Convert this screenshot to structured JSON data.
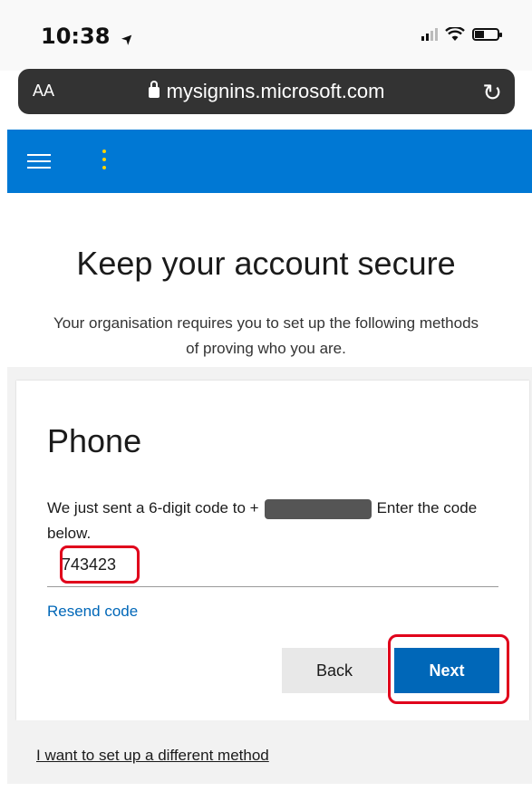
{
  "status_bar": {
    "time": "10:38",
    "location_arrow": "➤",
    "icons": [
      "signal-icon",
      "wifi-icon",
      "battery-icon"
    ]
  },
  "browser": {
    "text_size_label": "AA",
    "url": "mysignins.microsoft.com",
    "reload_glyph": "↻"
  },
  "header": {
    "accent": "#0078d4",
    "menu_icon": "hamburger-icon",
    "more_icon": "more-vertical-icon"
  },
  "page": {
    "title": "Keep your account secure",
    "subtitle_line1": "Your organisation requires you to set up the following methods",
    "subtitle_line2": "of proving who you are."
  },
  "card": {
    "title": "Phone",
    "instructions_prefix": "We just sent a 6-digit code to +",
    "instructions_suffix": "Enter the code below.",
    "code_value": "743423",
    "resend_label": "Resend code",
    "back_label": "Back",
    "next_label": "Next"
  },
  "footer": {
    "different_method_label": "I want to set up a different method"
  },
  "colors": {
    "primary_button": "#0067b8",
    "highlight": "#e0001b",
    "link": "#0067b8"
  }
}
